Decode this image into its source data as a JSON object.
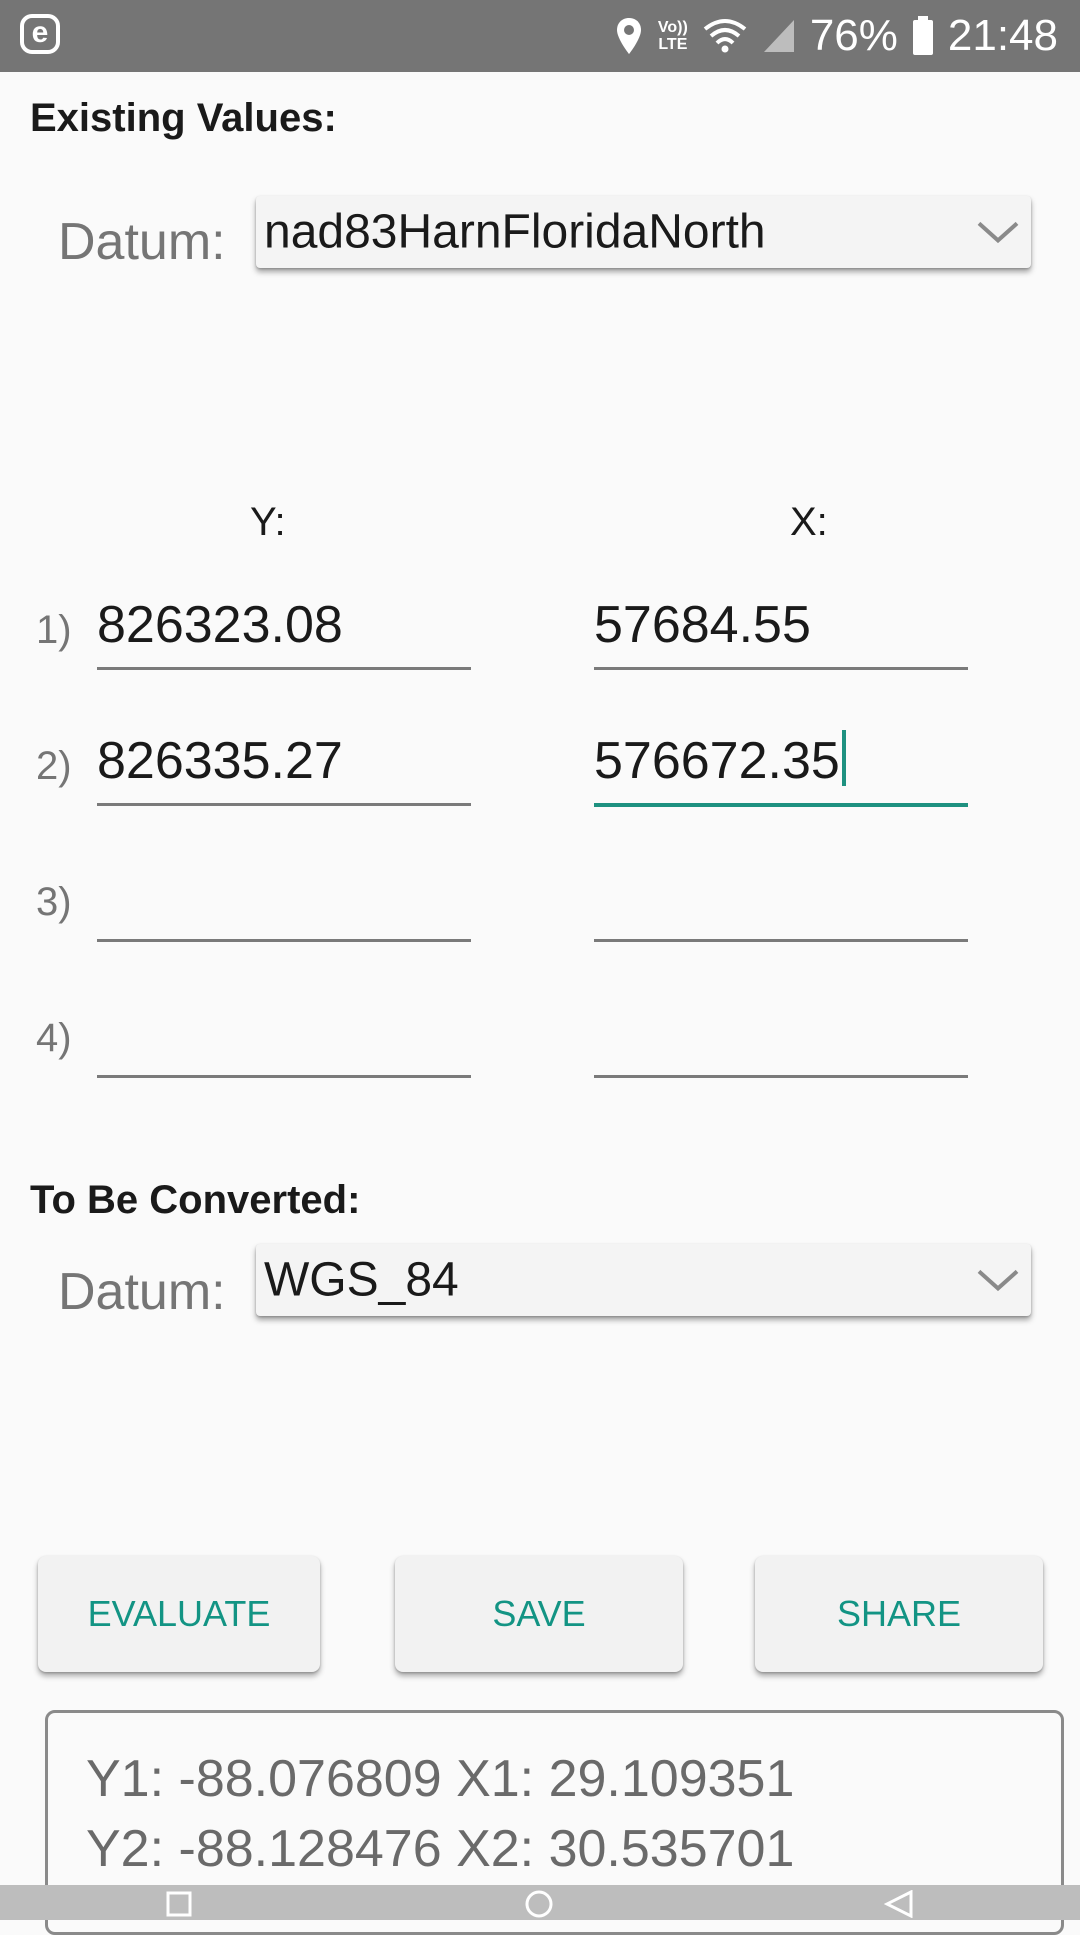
{
  "status_bar": {
    "app_letter": "e",
    "icons": [
      "location-icon",
      "volte-icon",
      "wifi-icon",
      "signal-icon",
      "battery-icon"
    ],
    "volte_top": "Vo))",
    "volte_bottom": "LTE",
    "battery": "76%",
    "time": "21:48"
  },
  "existing": {
    "title": "Existing Values:",
    "datum_label": "Datum:",
    "datum_value": "nad83HarnFloridaNorth"
  },
  "columns": {
    "y_header": "Y:",
    "x_header": "X:"
  },
  "rows": [
    {
      "label": "1)",
      "y": "826323.08",
      "x": "57684.55"
    },
    {
      "label": "2)",
      "y": "826335.27",
      "x": "576672.35"
    },
    {
      "label": "3)",
      "y": "",
      "x": ""
    },
    {
      "label": "4)",
      "y": "",
      "x": ""
    }
  ],
  "convert": {
    "title": "To Be Converted:",
    "datum_label": "Datum:",
    "datum_value": "WGS_84"
  },
  "buttons": {
    "evaluate": "EVALUATE",
    "save": "SAVE",
    "share": "SHARE"
  },
  "results": {
    "line1": "Y1: -88.076809   X1: 29.109351",
    "line2": "Y2: -88.128476   X2: 30.535701"
  },
  "colors": {
    "accent": "#139484",
    "status_bar": "#757575",
    "background": "#fafafa"
  }
}
